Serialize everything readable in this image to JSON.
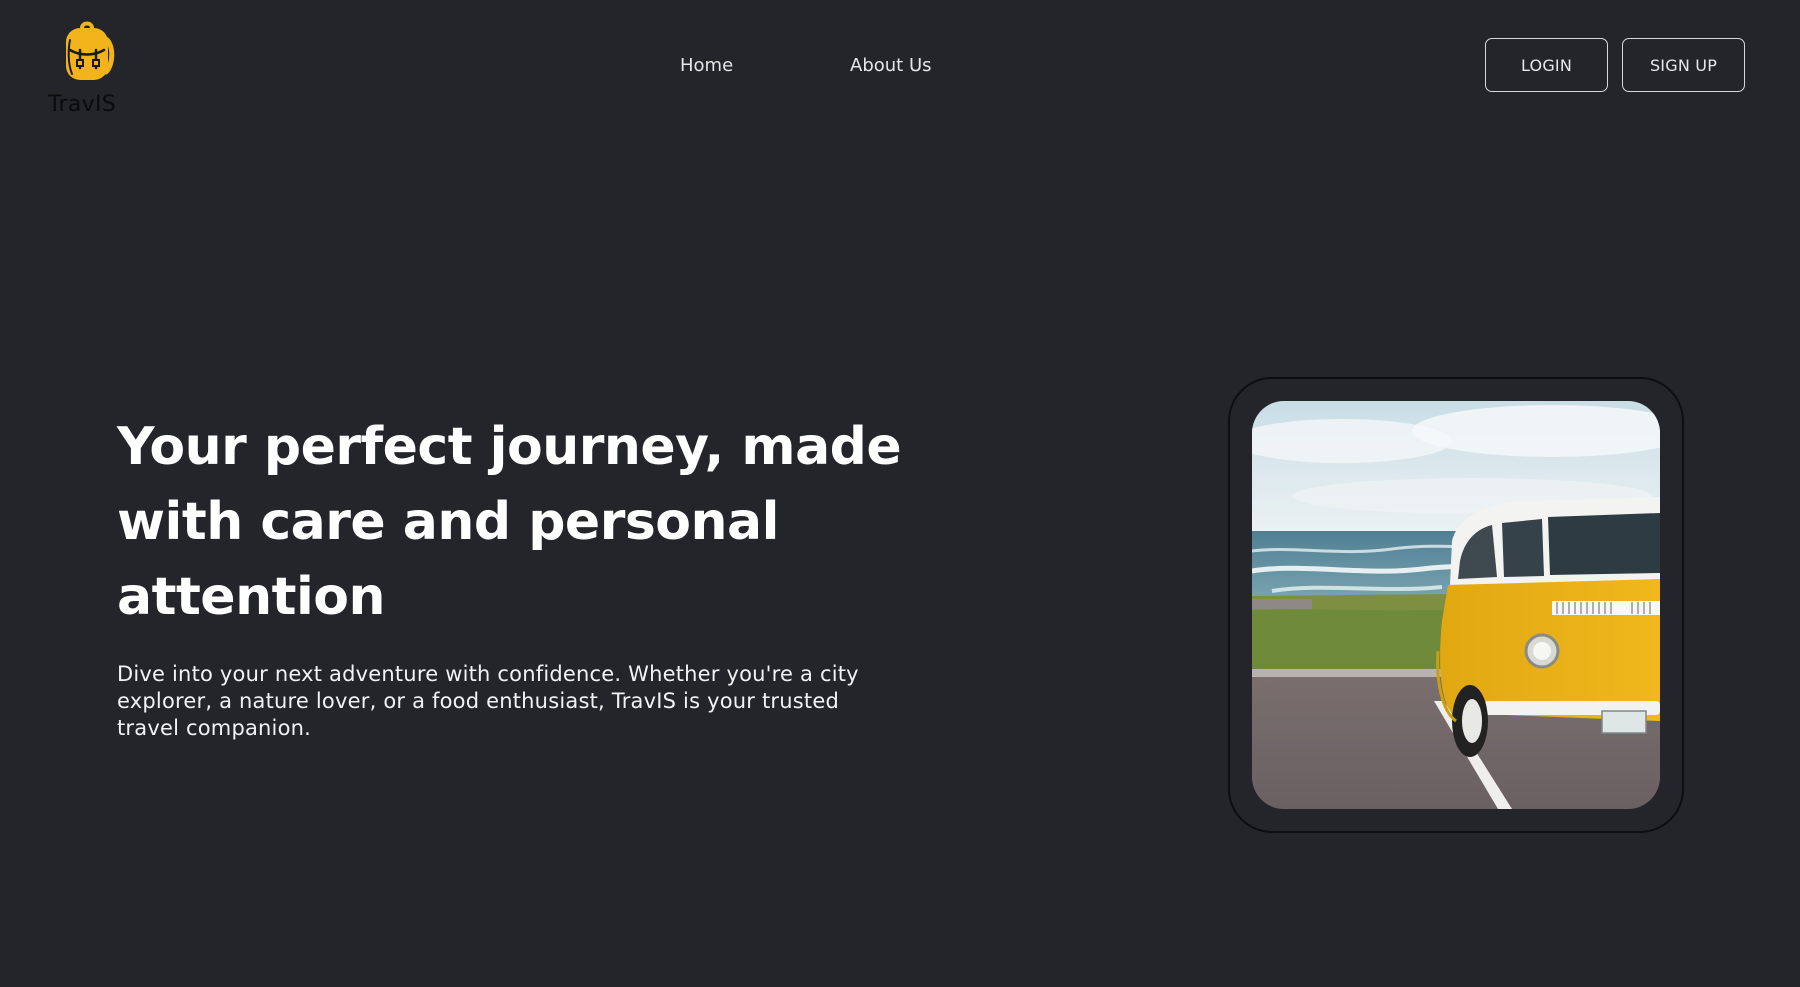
{
  "brand": {
    "name": "TravIS",
    "icon": "backpack-icon",
    "icon_color": "#f2b31b"
  },
  "nav": {
    "home_label": "Home",
    "about_label": "About Us"
  },
  "auth": {
    "login_label": "LOGIN",
    "signup_label": "SIGN UP"
  },
  "hero": {
    "title": "Your perfect journey, made with care and personal attention",
    "description": "Dive into your next adventure with confidence. Whether you're a city explorer, a nature lover, or a food enthusiast, TravIS is your trusted travel companion.",
    "image_alt": "Yellow van parked by the sea"
  },
  "colors": {
    "background": "#24252b",
    "accent": "#f2b31b",
    "text": "#ffffff"
  }
}
